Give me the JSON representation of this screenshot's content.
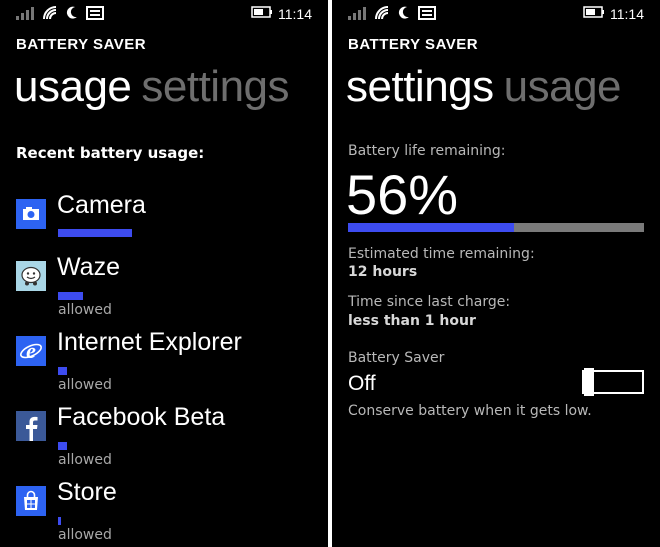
{
  "status": {
    "time": "11:14"
  },
  "usage_screen": {
    "app_title": "BATTERY SAVER",
    "pivot_active": "usage",
    "pivot_inactive": "settings",
    "section_heading": "Recent battery usage:",
    "apps": [
      {
        "name": "Camera",
        "usage_fraction": 0.25,
        "tile_color": "#2d63f2",
        "icon": "camera-icon",
        "status": ""
      },
      {
        "name": "Waze",
        "usage_fraction": 0.08,
        "tile_color": "#a9d6e6",
        "icon": "waze-icon",
        "status": "allowed"
      },
      {
        "name": "Internet Explorer",
        "usage_fraction": 0.03,
        "tile_color": "#2d63f2",
        "icon": "internet-explorer-icon",
        "status": "allowed"
      },
      {
        "name": "Facebook Beta",
        "usage_fraction": 0.03,
        "tile_color": "#3b5998",
        "icon": "facebook-icon",
        "status": "allowed"
      },
      {
        "name": "Store",
        "usage_fraction": 0.01,
        "tile_color": "#2d63f2",
        "icon": "store-icon",
        "status": "allowed"
      }
    ]
  },
  "settings_screen": {
    "app_title": "BATTERY SAVER",
    "pivot_active": "settings",
    "pivot_inactive": "usage",
    "life_label": "Battery life remaining:",
    "life_percent": "56%",
    "life_fraction": 0.56,
    "estimated_label": "Estimated time remaining:",
    "estimated_value": "12 hours",
    "since_charge_label": "Time since last charge:",
    "since_charge_value": "less than 1 hour",
    "saver_label": "Battery Saver",
    "saver_state": "Off",
    "saver_description": "Conserve battery when it gets low."
  },
  "colors": {
    "accent": "#3d4cf0",
    "background": "#000000",
    "inactive_text": "#6e6e6e"
  }
}
